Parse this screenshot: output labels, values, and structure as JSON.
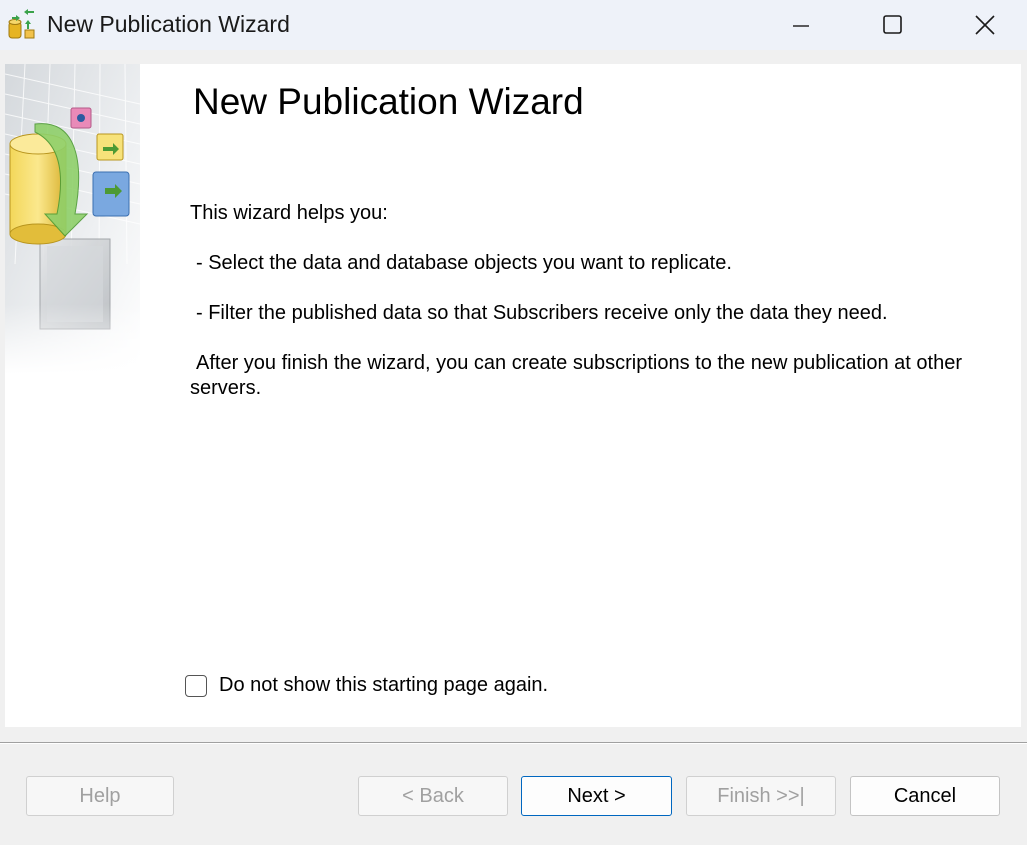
{
  "window": {
    "title": "New Publication Wizard"
  },
  "page": {
    "heading": "New Publication Wizard",
    "intro": "This wizard helps you:",
    "bullets": [
      "- Select the data and database objects you want to replicate.",
      "- Filter the published data so that Subscribers receive only the data they need."
    ],
    "after_text": "After you finish the wizard, you can create subscriptions to the new publication at other servers.",
    "checkbox": {
      "label": "Do not show this starting page again.",
      "checked": false
    }
  },
  "buttons": {
    "help": "Help",
    "back": "< Back",
    "next": "Next >",
    "finish": "Finish >>|",
    "cancel": "Cancel"
  },
  "icons": {
    "app": "publication-wizard-icon",
    "minimize": "minimize-icon",
    "maximize": "maximize-icon",
    "close": "close-icon"
  },
  "colors": {
    "titlebar": "#eef2f9",
    "accent": "#0067c0",
    "disabled_text": "#a0a0a0"
  }
}
